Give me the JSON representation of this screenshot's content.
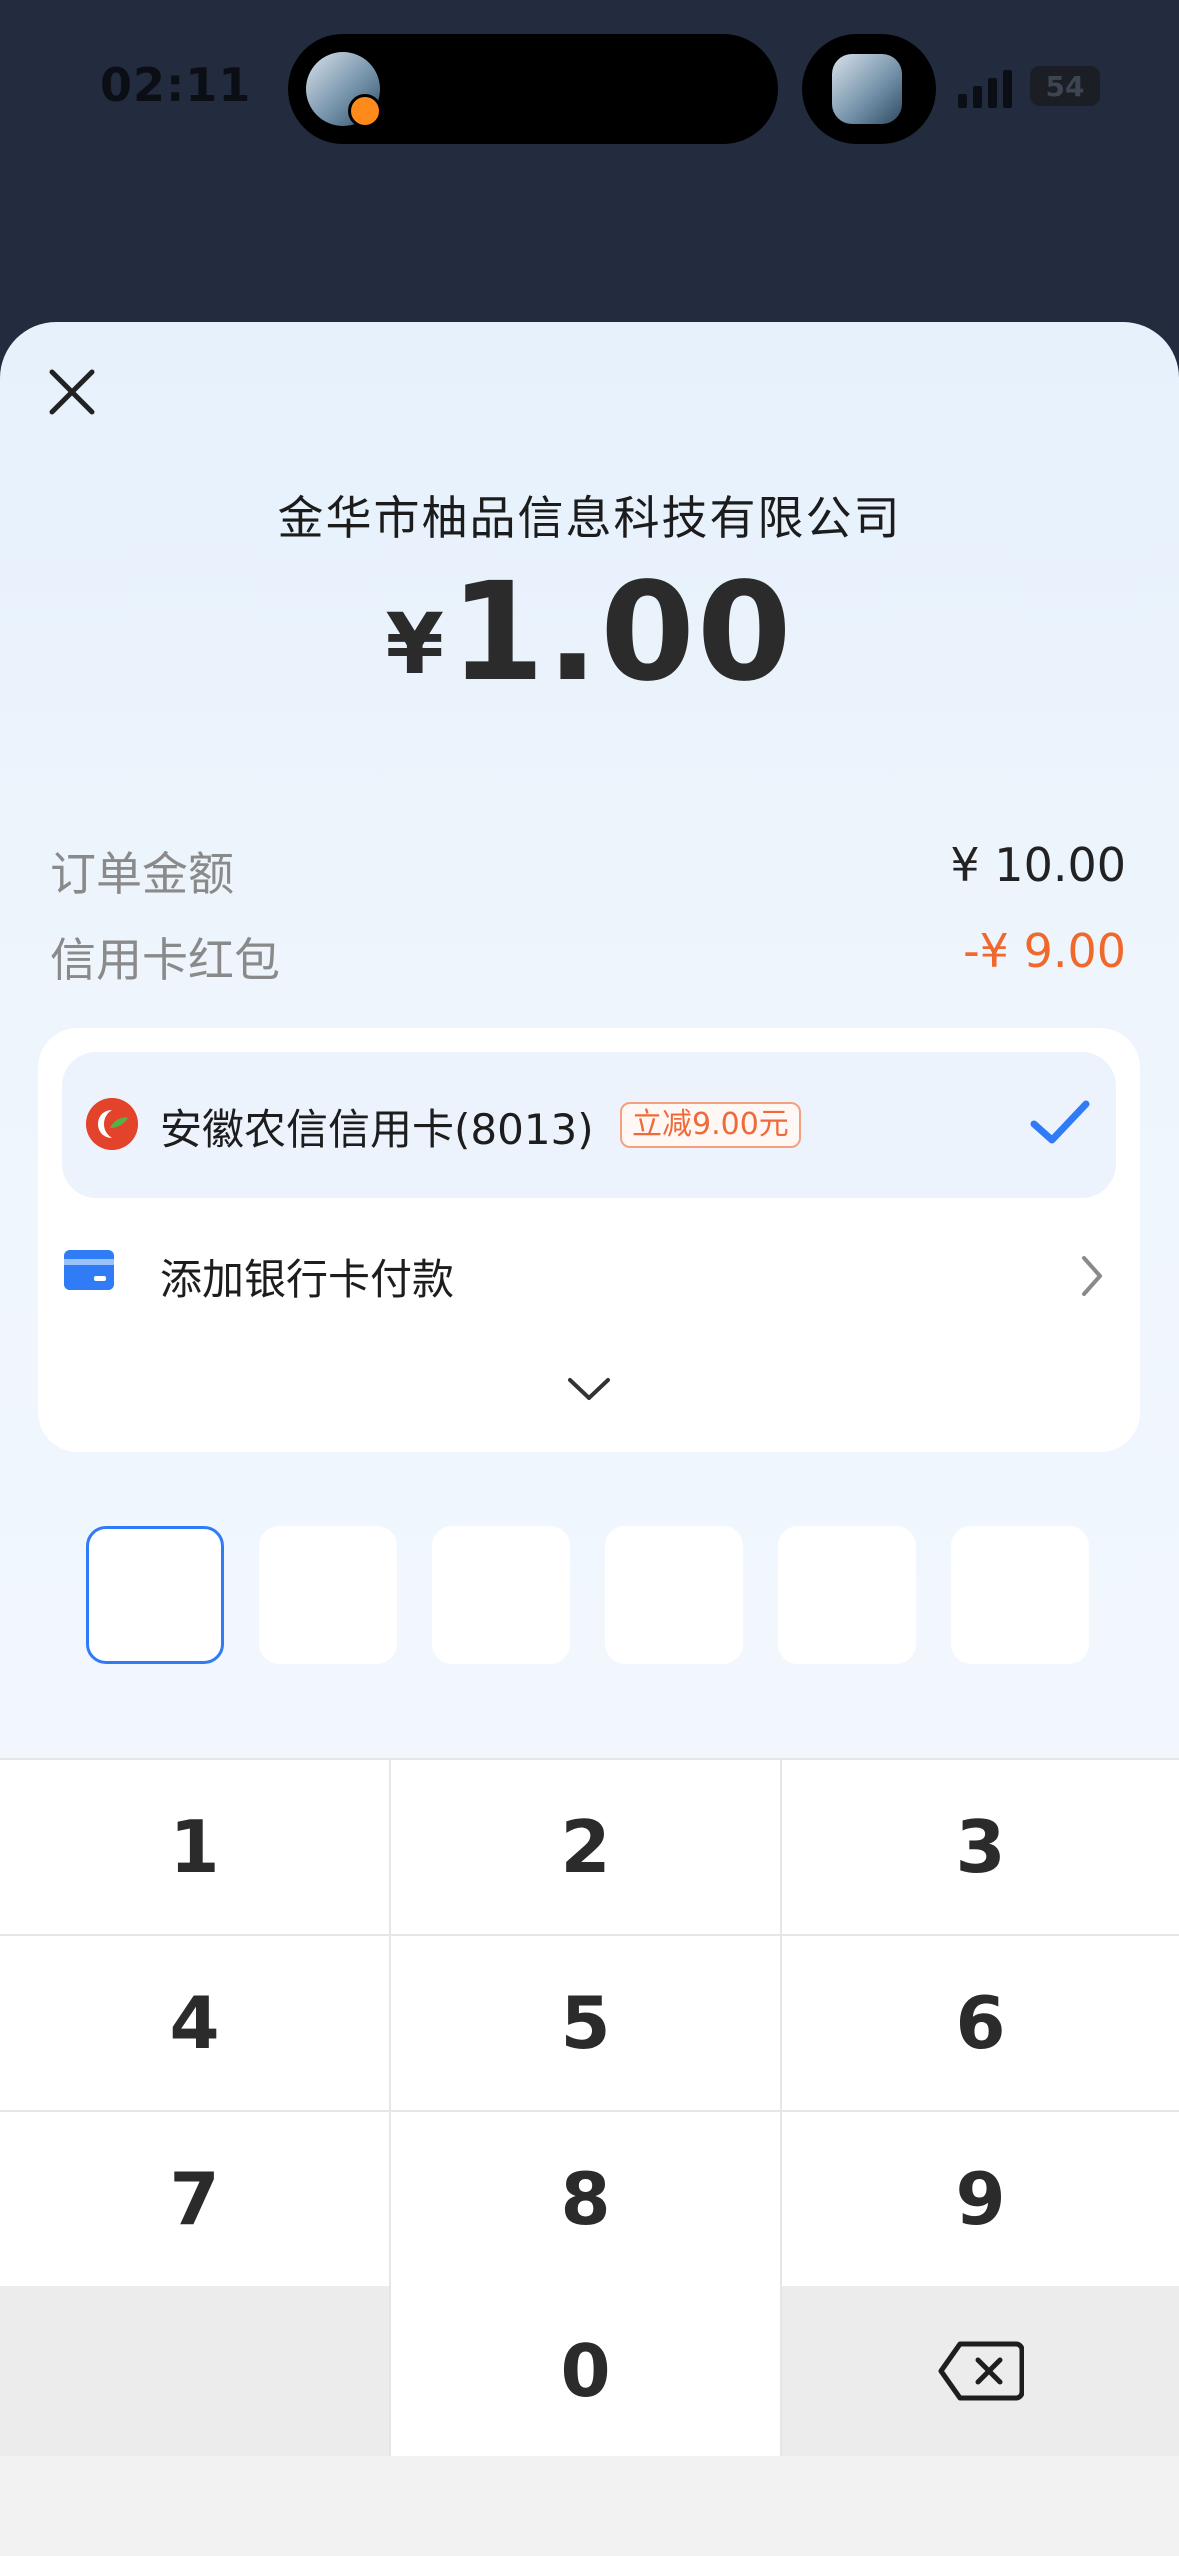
{
  "status_bar": {
    "time": "02:11",
    "battery": "54"
  },
  "payment": {
    "merchant": "金华市柚品信息科技有限公司",
    "currency_symbol": "¥",
    "amount": "1.00"
  },
  "summary": [
    {
      "label": "订单金额",
      "value": "¥ 10.00",
      "color": "#222222"
    },
    {
      "label": "信用卡红包",
      "value": "-¥ 9.00",
      "color": "#f0682c"
    }
  ],
  "methods": {
    "selected": {
      "name": "安徽农信信用卡(8013)",
      "promo": "立减9.00元"
    },
    "add_card": {
      "name": "添加银行卡付款"
    }
  },
  "keypad": {
    "keys": [
      "1",
      "2",
      "3",
      "4",
      "5",
      "6",
      "7",
      "8",
      "9",
      "0"
    ]
  },
  "colors": {
    "accent": "#2f7cf6",
    "discount": "#f0682c",
    "background_top": "#232b3e"
  }
}
